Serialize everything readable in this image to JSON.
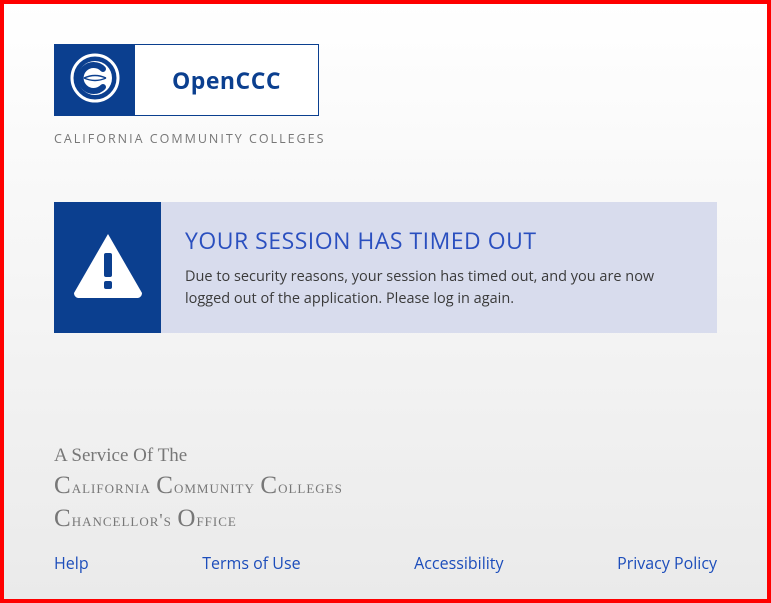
{
  "header": {
    "logo_text": "OpenCCC",
    "subtitle": "CALIFORNIA COMMUNITY COLLEGES"
  },
  "alert": {
    "title": "YOUR SESSION HAS TIMED OUT",
    "message": "Due to security reasons, your session has timed out, and you are now logged out of the application. Please log in again."
  },
  "footer": {
    "service_of": "A Service Of The",
    "agency_line1": "California Community Colleges",
    "agency_line2": "Chancellor's Office",
    "links": {
      "help": "Help",
      "terms": "Terms of Use",
      "accessibility": "Accessibility",
      "privacy": "Privacy Policy"
    }
  },
  "colors": {
    "brand": "#0b3f8f",
    "alert_bg": "#d8dced"
  }
}
